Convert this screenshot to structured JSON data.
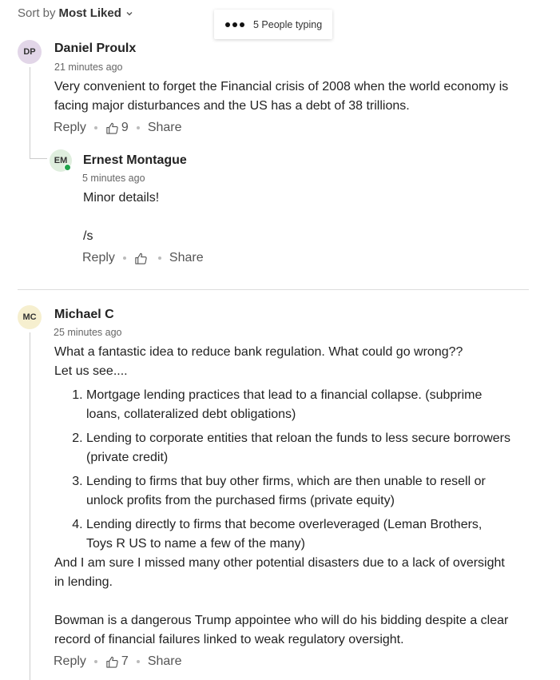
{
  "sort": {
    "prefix": "Sort by",
    "value": "Most Liked"
  },
  "typing": {
    "label": "5 People typing"
  },
  "colors": {
    "av_dp": "#e2d6e8",
    "av_em": "#dfeede",
    "av_mc": "#f6efcf",
    "online": "#1fa34a"
  },
  "comments": [
    {
      "initials": "DP",
      "author": "Daniel Proulx",
      "time": "21 minutes ago",
      "text": [
        "Very convenient to forget the Financial crisis of 2008  when the world economy is facing major disturbances and the US has a debt of 38 trillions."
      ],
      "reply_label": "Reply",
      "likes": "9",
      "share_label": "Share"
    },
    {
      "initials": "EM",
      "author": "Ernest Montague",
      "time": "5 minutes ago",
      "text": [
        "Minor details!",
        "/s"
      ],
      "reply_label": "Reply",
      "likes": "",
      "share_label": "Share"
    },
    {
      "initials": "MC",
      "author": "Michael C",
      "time": "25 minutes ago",
      "intro": [
        "What a fantastic idea to reduce bank regulation. What could go wrong??",
        "Let us see...."
      ],
      "list": [
        "Mortgage lending practices that lead to a financial collapse. (subprime loans, collateralized debt obligations)",
        "Lending to corporate entities that reloan the funds to less secure borrowers (private credit)",
        "Lending to firms that buy other firms,  which are then unable to resell or unlock profits from the purchased firms (private equity)",
        "Lending directly to firms that become overleveraged (Leman Brothers, Toys R US to name a few of the many)"
      ],
      "outro": [
        "And I am sure I missed many other potential disasters due to a lack of oversight in lending.",
        "Bowman is a dangerous Trump appointee who will do his bidding despite a clear record of financial failures linked to weak regulatory oversight."
      ],
      "reply_label": "Reply",
      "likes": "7",
      "share_label": "Share"
    }
  ]
}
